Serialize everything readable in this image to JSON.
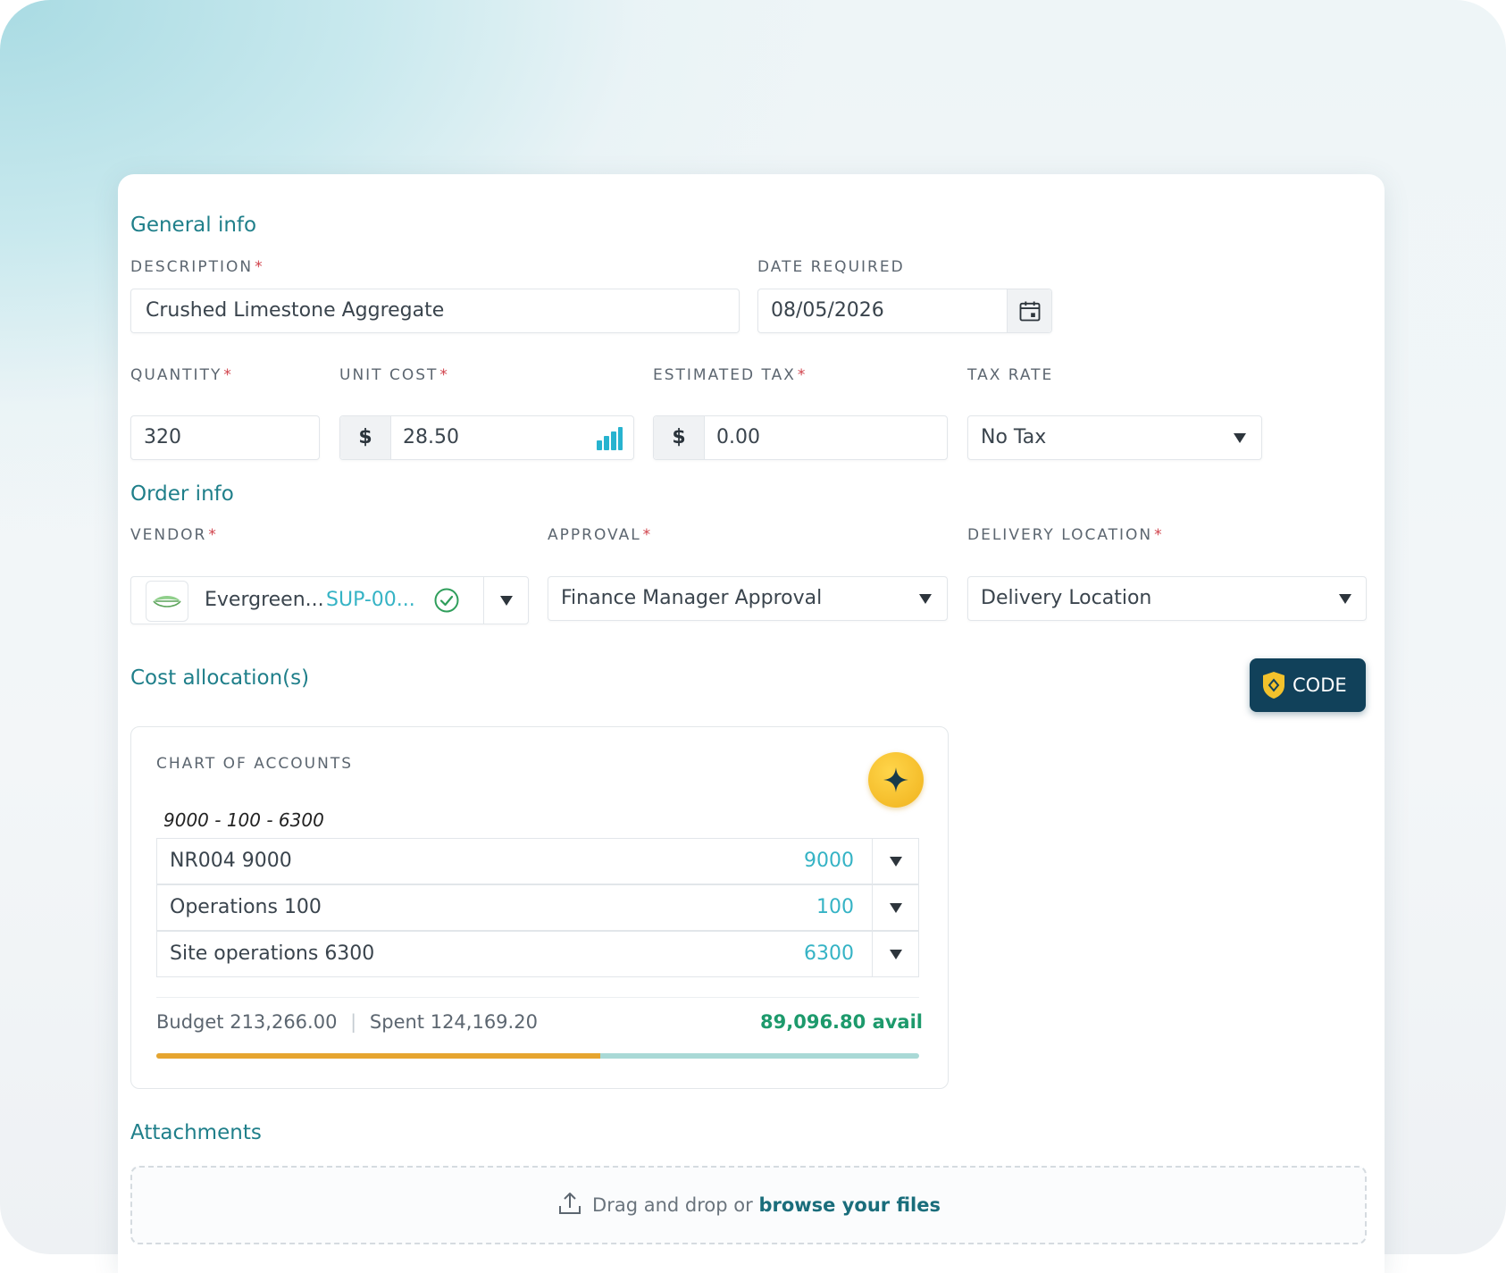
{
  "sections": {
    "general": "General info",
    "order": "Order info",
    "cost": "Cost allocation(s)",
    "attachments": "Attachments"
  },
  "general": {
    "description_label": "DESCRIPTION",
    "description_value": "Crushed Limestone Aggregate",
    "date_label": "DATE REQUIRED",
    "date_value": "08/05/2026",
    "quantity_label": "QUANTITY",
    "quantity_value": "320",
    "unit_cost_label": "UNIT COST",
    "unit_cost_prefix": "$",
    "unit_cost_value": "28.50",
    "est_tax_label": "ESTIMATED TAX",
    "est_tax_prefix": "$",
    "est_tax_value": "0.00",
    "tax_rate_label": "TAX RATE",
    "tax_rate_value": "No Tax"
  },
  "order": {
    "vendor_label": "VENDOR",
    "vendor_name": "Evergreen...",
    "vendor_code": "SUP-00...",
    "approval_label": "APPROVAL",
    "approval_value": "Finance Manager Approval",
    "delivery_label": "DELIVERY LOCATION",
    "delivery_value": "Delivery Location"
  },
  "required_mark": "*",
  "code_button": "CODE",
  "coa": {
    "title": "CHART OF ACCOUNTS",
    "combined": "9000 - 100 - 6300",
    "rows": [
      {
        "name": "NR004 9000",
        "code": "9000"
      },
      {
        "name": "Operations 100",
        "code": "100"
      },
      {
        "name": "Site operations 6300",
        "code": "6300"
      }
    ],
    "budget_text": "Budget 213,266.00",
    "separator": "|",
    "spent_text": "Spent 124,169.20",
    "available_text": "89,096.80 avail",
    "spent_fraction": 0.582
  },
  "attachments": {
    "text": "Drag and drop or",
    "link": "browse your files"
  },
  "colors": {
    "accent": "#1f7f8a",
    "required": "#d0414a",
    "code_button": "#11415a",
    "budget_spent": "#e6a530",
    "budget_remaining": "#a9d9d6",
    "available": "#1d9a6c",
    "account_code": "#35b3c5"
  },
  "icons": {
    "calendar": "calendar-icon",
    "chart": "bar-chart-icon",
    "vendor_logo": "vendor-logo-icon",
    "verified": "check-circle-icon",
    "code_badge": "code-badge-icon",
    "ai_sparkle": "sparkle-icon",
    "upload": "upload-icon",
    "dropdown": "chevron-down-icon"
  }
}
